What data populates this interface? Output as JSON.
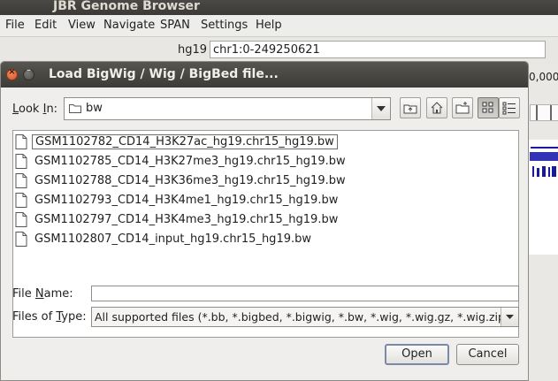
{
  "main_window": {
    "title": "JBR Genome Browser",
    "menu": [
      "File",
      "Edit",
      "View",
      "Navigate",
      "SPAN",
      "Settings",
      "Help"
    ],
    "genome": "hg19",
    "locus": "chr1:0-249250621",
    "position_fragment": "0,000"
  },
  "dialog": {
    "title": "Load BigWig / Wig / BigBed file...",
    "look_in_label": "Look In:",
    "look_in_value": "bw",
    "toolbar_icons": [
      "up-folder-icon",
      "home-icon",
      "new-folder-icon",
      "list-view-icon",
      "details-view-icon"
    ],
    "files": [
      "GSM1102782_CD14_H3K27ac_hg19.chr15_hg19.bw",
      "GSM1102785_CD14_H3K27me3_hg19.chr15_hg19.bw",
      "GSM1102788_CD14_H3K36me3_hg19.chr15_hg19.bw",
      "GSM1102793_CD14_H3K4me1_hg19.chr15_hg19.bw",
      "GSM1102797_CD14_H3K4me3_hg19.chr15_hg19.bw",
      "GSM1102807_CD14_input_hg19.chr15_hg19.bw"
    ],
    "selected_file": "GSM1102782_CD14_H3K27ac_hg19.chr15_hg19.bw",
    "file_name_label": "File Name:",
    "file_name_value": "",
    "files_of_type_label": "Files of Type:",
    "files_of_type_value": "All supported files (*.bb, *.bigbed, *.bigwig, *.bw, *.wig, *.wig.gz, *.wig.zip)",
    "open_label": "Open",
    "cancel_label": "Cancel"
  }
}
